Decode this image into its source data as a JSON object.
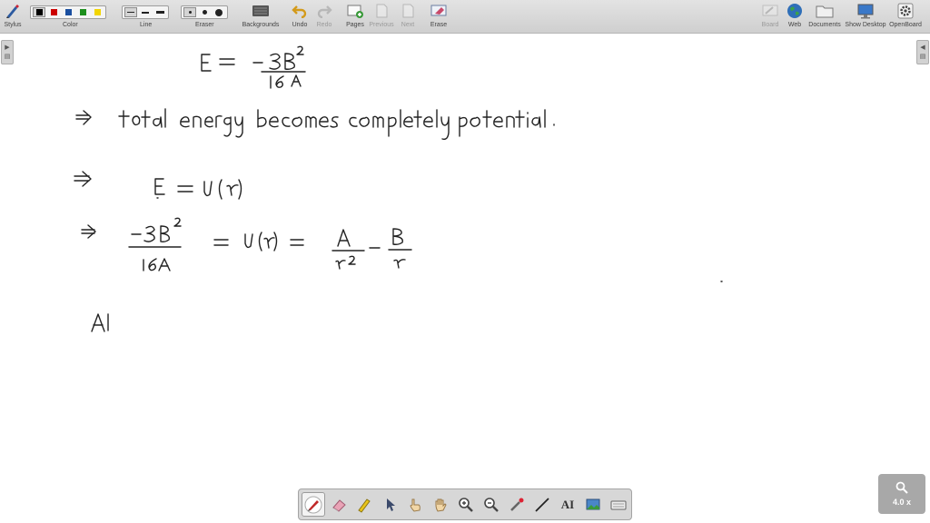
{
  "toolbar": {
    "stylus": {
      "label": "Stylus",
      "icon": "stylus-icon"
    },
    "color": {
      "label": "Color",
      "swatches": [
        "#000000",
        "#cc0000",
        "#1a4fa0",
        "#1d8f1d",
        "#f2d500"
      ],
      "selected_index": 0
    },
    "line": {
      "label": "Line",
      "selected_index": 0
    },
    "eraser": {
      "label": "Eraser",
      "selected_index": 0
    },
    "backgrounds": {
      "label": "Backgrounds",
      "icon": "backgrounds-icon"
    },
    "undo": {
      "label": "Undo",
      "icon": "undo-icon"
    },
    "redo": {
      "label": "Redo",
      "icon": "redo-icon"
    },
    "pages": {
      "label": "Pages",
      "icon": "pages-icon"
    },
    "previous": {
      "label": "Previous",
      "icon": "previous-page-icon"
    },
    "next": {
      "label": "Next",
      "icon": "next-page-icon"
    },
    "erase": {
      "label": "Erase",
      "icon": "erase-board-icon"
    },
    "board": {
      "label": "Board",
      "icon": "board-icon"
    },
    "web": {
      "label": "Web",
      "icon": "globe-icon"
    },
    "documents": {
      "label": "Documents",
      "icon": "folder-icon"
    },
    "show_desktop": {
      "label": "Show Desktop",
      "icon": "desktop-icon"
    },
    "openboard": {
      "label": "OpenBoard",
      "icon": "gear-icon"
    }
  },
  "accent": "#333333",
  "zoom": {
    "text": "4.0 x",
    "icon": "magnifier-icon"
  },
  "palette": {
    "tools": [
      "pen-icon",
      "eraser-icon",
      "highlighter-icon",
      "pointer-icon",
      "selector-hand-icon",
      "hand-icon",
      "zoom-in-icon",
      "zoom-out-icon",
      "laser-pointer-icon",
      "line-icon",
      "text-tool-icon",
      "capture-icon",
      "virtual-keyboard-icon"
    ],
    "selected_index": 0,
    "text_tool_label": "AI"
  },
  "board": {
    "lines": [
      "E = − 3B² / 16 A",
      "⇒ total energy becomes completely potential.",
      "⇒ E = U(r)",
      "⇒ − 3B² / 16A = U(r) = A/r² − B/r",
      "Al"
    ]
  }
}
